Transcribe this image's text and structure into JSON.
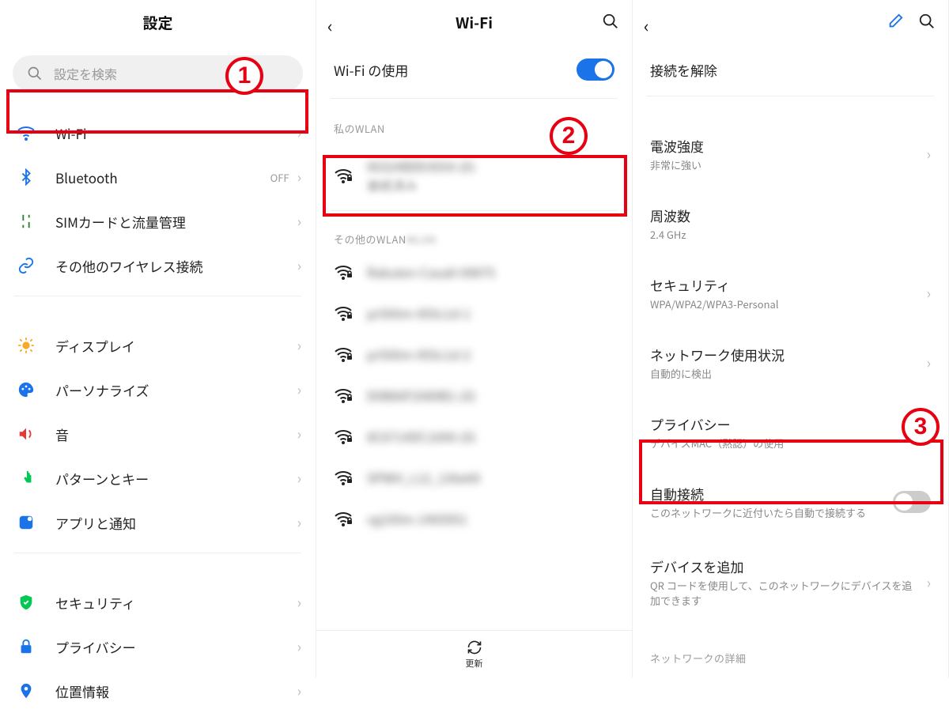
{
  "panel1": {
    "title": "設定",
    "search_placeholder": "設定を検索",
    "items": [
      {
        "label": "Wi-Fi",
        "status": ""
      },
      {
        "label": "Bluetooth",
        "status": "OFF"
      },
      {
        "label": "SIMカードと流量管理",
        "status": ""
      },
      {
        "label": "その他のワイヤレス接続",
        "status": ""
      }
    ],
    "items2": [
      {
        "label": "ディスプレイ"
      },
      {
        "label": "パーソナライズ"
      },
      {
        "label": "音"
      },
      {
        "label": "パターンとキー"
      },
      {
        "label": "アプリと通知"
      }
    ],
    "items3": [
      {
        "label": "セキュリティ"
      },
      {
        "label": "プライバシー"
      },
      {
        "label": "位置情報"
      }
    ]
  },
  "panel2": {
    "title": "Wi-Fi",
    "use_wifi_label": "Wi-Fi の使用",
    "use_wifi_on": true,
    "my_wlan_header": "私のWLAN",
    "my_network": {
      "ssid": "90324BDE4554-2G",
      "sub": "接続済み"
    },
    "other_header": "その他のWLAN",
    "others": [
      {
        "ssid": "Rakuten-Casa8-09875"
      },
      {
        "ssid": "pr500m-955c1d-1"
      },
      {
        "ssid": "pr500m-955c1d-2"
      },
      {
        "ssid": "D0B66F2089B1-2G"
      },
      {
        "ssid": "8C6714DC10A9-2G"
      },
      {
        "ssid": "SPWH_L12_130e69"
      },
      {
        "ssid": "vg100m-1465951"
      }
    ],
    "refresh_label": "更新"
  },
  "panel3": {
    "disconnect_label": "接続を解除",
    "signal": {
      "title": "電波強度",
      "value": "非常に強い"
    },
    "freq": {
      "title": "周波数",
      "value": "2.4 GHz"
    },
    "security": {
      "title": "セキュリティ",
      "value": "WPA/WPA2/WPA3-Personal"
    },
    "usage": {
      "title": "ネットワーク使用状況",
      "value": "自動的に検出"
    },
    "privacy": {
      "title": "プライバシー",
      "value": "デバイスMAC（黙認）の使用"
    },
    "autoconnect": {
      "title": "自動接続",
      "desc": "このネットワークに近付いたら自動で接続する",
      "on": false
    },
    "add_device": {
      "title": "デバイスを追加",
      "desc": "QR コードを使用して、このネットワークにデバイスを追加できます"
    },
    "detail_header": "ネットワークの詳細"
  },
  "anno": {
    "b1": "1",
    "b2": "2",
    "b3": "3"
  }
}
